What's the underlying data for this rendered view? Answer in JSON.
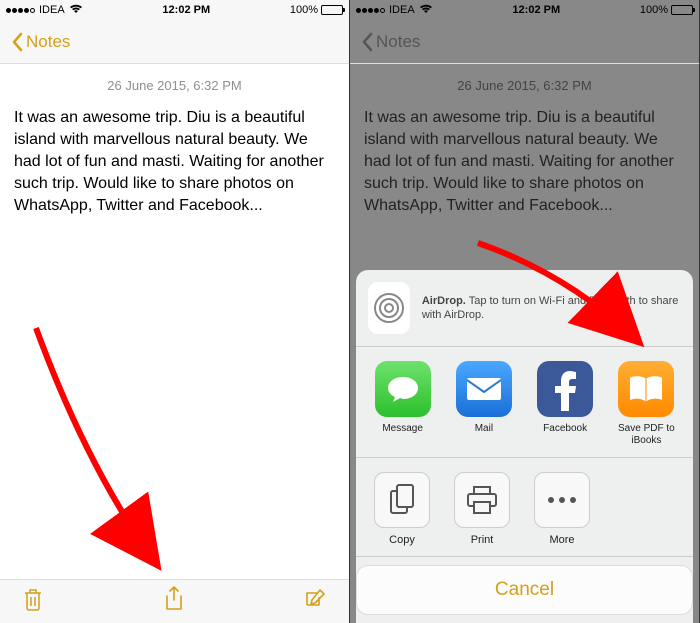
{
  "status": {
    "carrier": "IDEA",
    "time": "12:02 PM",
    "battery_pct": "100%"
  },
  "nav": {
    "back_label": "Notes"
  },
  "note": {
    "timestamp": "26 June 2015, 6:32 PM",
    "body": "It was an awesome trip. Diu is a beautiful island with marvellous natural beauty. We had lot of fun and masti. Waiting for another such trip. Would like to share photos on WhatsApp, Twitter and Facebook..."
  },
  "share": {
    "airdrop_bold": "AirDrop.",
    "airdrop_rest": " Tap to turn on Wi-Fi and Bluetooth to share with AirDrop.",
    "apps": [
      {
        "label": "Message"
      },
      {
        "label": "Mail"
      },
      {
        "label": "Facebook"
      },
      {
        "label": "Save PDF to iBooks"
      }
    ],
    "actions": [
      {
        "label": "Copy"
      },
      {
        "label": "Print"
      },
      {
        "label": "More"
      }
    ],
    "cancel": "Cancel"
  }
}
